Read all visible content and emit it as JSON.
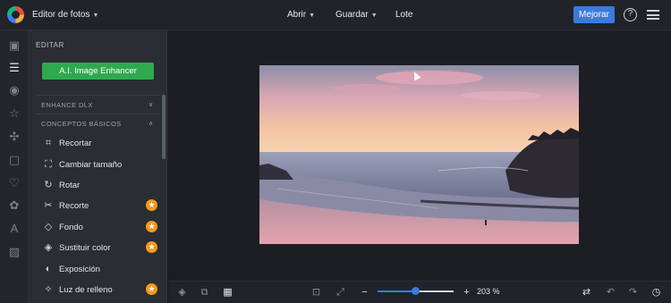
{
  "topbar": {
    "app_title": "Editor de fotos",
    "nav": [
      {
        "label": "Abrir"
      },
      {
        "label": "Guardar"
      },
      {
        "label": "Lote"
      }
    ],
    "primary_button": "Mejorar",
    "help_glyph": "?"
  },
  "sidebar": {
    "section_label": "EDITAR",
    "enhancer_button": "A.I. Image Enhancer",
    "sections": [
      {
        "label": "ENHANCE DLX"
      },
      {
        "label": "CONCEPTOS BÁSICOS"
      }
    ],
    "items": [
      {
        "label": "Recortar",
        "icon": "crop-icon",
        "premium": false
      },
      {
        "label": "Cambiar tamaño",
        "icon": "resize-icon",
        "premium": false
      },
      {
        "label": "Rotar",
        "icon": "rotate-icon",
        "premium": false
      },
      {
        "label": "Recorte",
        "icon": "scissors-icon",
        "premium": true
      },
      {
        "label": "Fondo",
        "icon": "background-icon",
        "premium": true
      },
      {
        "label": "Sustituir color",
        "icon": "replace-color-icon",
        "premium": true
      },
      {
        "label": "Exposición",
        "icon": "exposure-icon",
        "premium": false
      },
      {
        "label": "Luz de relleno",
        "icon": "fill-light-icon",
        "premium": true
      }
    ]
  },
  "bottombar": {
    "zoom_level": 203,
    "zoom_label": "203 %",
    "zoom_minus": "−",
    "zoom_plus": "+"
  },
  "colors": {
    "accent": "#3a7bdc",
    "enhancer": "#2eaa4e",
    "premium_star": "#f39a1b"
  }
}
